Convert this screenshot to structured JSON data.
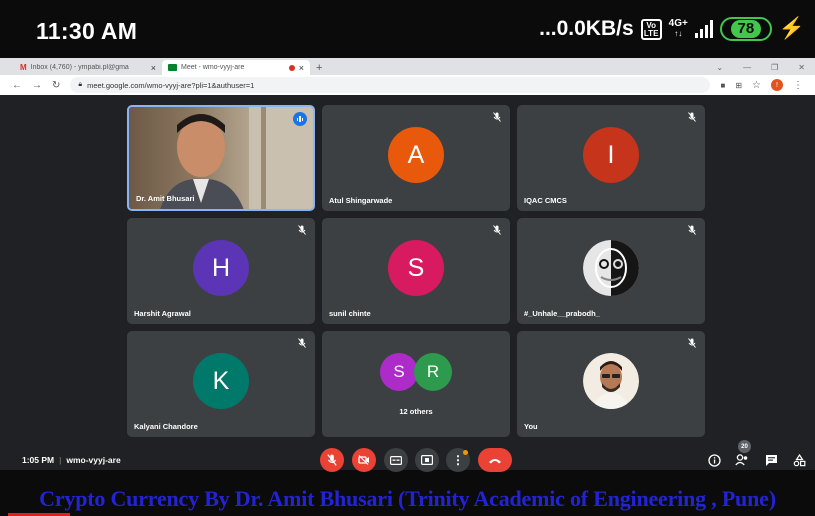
{
  "status_bar": {
    "time": "11:30 AM",
    "network_speed": "...0.0KB/s",
    "volte_badge": "Vo\nLTE",
    "network_type": "4G+",
    "battery": "78"
  },
  "browser": {
    "tabs": [
      {
        "label": "Inbox (4,760) - ympabi.pl@gma",
        "icon": "gmail-icon",
        "icon_color": "#d93025"
      },
      {
        "label": "Meet - wmo-vyyj-are",
        "icon": "meet-icon",
        "icon_color": "#00832d"
      }
    ],
    "url": "meet.google.com/wmo-vyyj-are?pli=1&authuser=1",
    "profile_letter": "!"
  },
  "meet": {
    "tiles": [
      {
        "name": "Dr. Amit Bhusari",
        "type": "video",
        "speaking": true
      },
      {
        "name": "Atul Shingarwade",
        "type": "letter",
        "letter": "A",
        "color": "#e8590c"
      },
      {
        "name": "IQAC CMCS",
        "type": "letter",
        "letter": "I",
        "color": "#c5341b"
      },
      {
        "name": "Harshit Agrawal",
        "type": "letter",
        "letter": "H",
        "color": "#5b35b5"
      },
      {
        "name": "sunil chinte",
        "type": "letter",
        "letter": "S",
        "color": "#d81b60"
      },
      {
        "name": "#_Unhale__prabodh_",
        "type": "photo"
      },
      {
        "name": "Kalyani Chandore",
        "type": "letter",
        "letter": "K",
        "color": "#00796b"
      },
      {
        "name": "12 others",
        "type": "others",
        "letters": [
          "S",
          "R"
        ],
        "colors": [
          "#ad2bc9",
          "#2e9a4e"
        ]
      },
      {
        "name": "You",
        "type": "photo"
      }
    ],
    "meeting_time": "1:05 PM",
    "meeting_code": "wmo-vyyj-are",
    "participant_count": "20"
  },
  "caption": "Crypto Currency By Dr. Amit Bhusari (Trinity Academic of Engineering , Pune)"
}
